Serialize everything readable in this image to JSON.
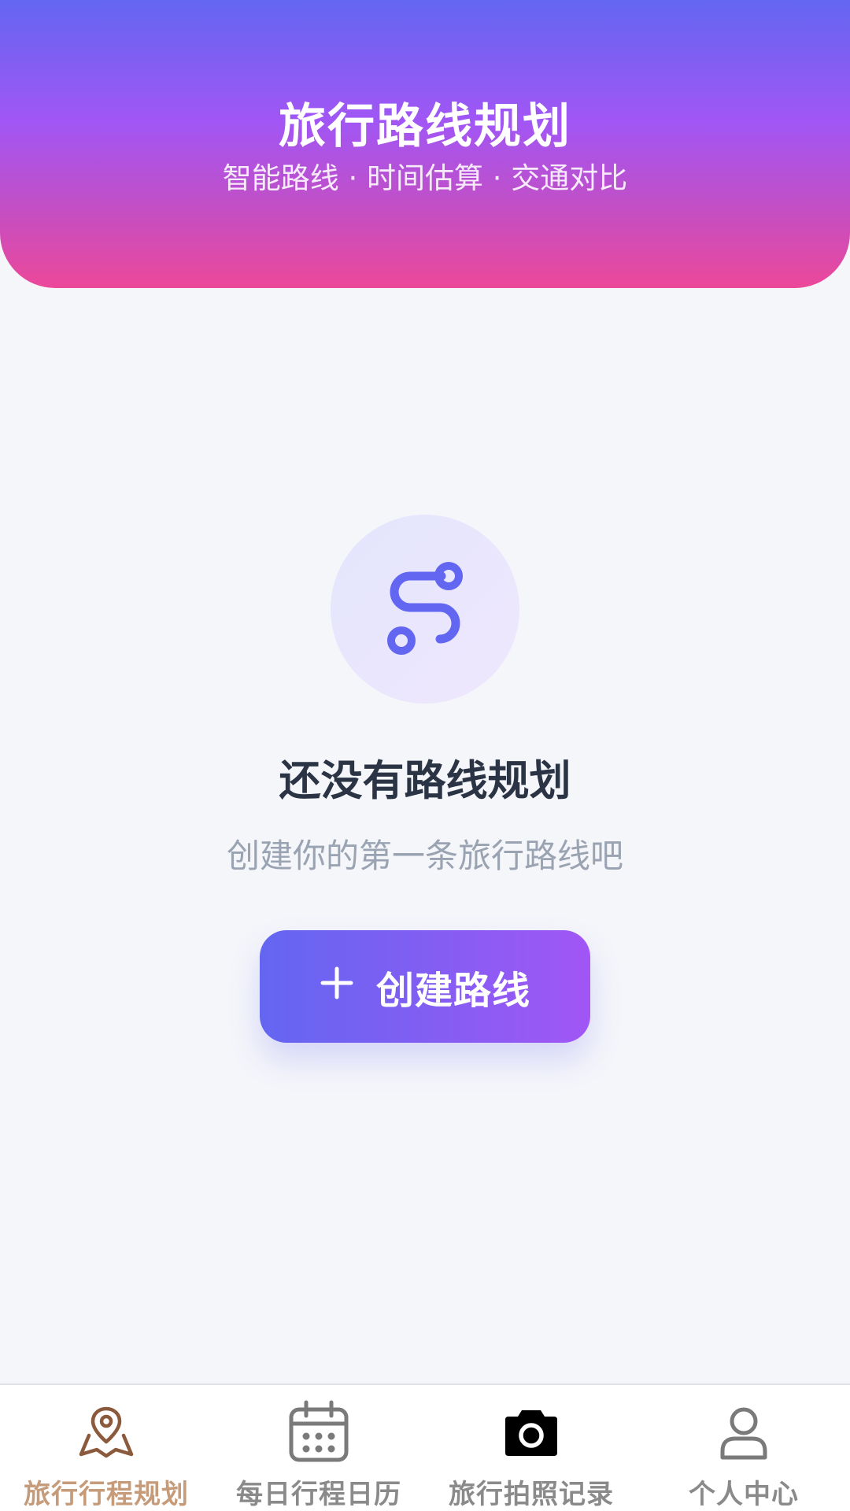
{
  "header": {
    "title": "旅行路线规划",
    "subtitle": "智能路线 · 时间估算 · 交通对比"
  },
  "empty_state": {
    "icon": "route-icon",
    "title": "还没有路线规划",
    "description": "创建你的第一条旅行路线吧",
    "create_button": {
      "icon": "plus-icon",
      "label": "创建路线"
    }
  },
  "bottom_nav": {
    "items": [
      {
        "label": "旅行行程规划",
        "icon": "map-pin-icon",
        "active": true
      },
      {
        "label": "每日行程日历",
        "icon": "calendar-icon",
        "active": false
      },
      {
        "label": "旅行拍照记录",
        "icon": "camera-icon",
        "active": false
      },
      {
        "label": "个人中心",
        "icon": "user-icon",
        "active": false
      }
    ]
  },
  "colors": {
    "header_gradient": [
      "#6366f1",
      "#a156f5",
      "#ec4899"
    ],
    "button_gradient": [
      "#6366f1",
      "#a156f5"
    ],
    "active_tab": "#c59b79",
    "inactive_tab": "#8a8a8a",
    "route_icon": "#6366f1"
  }
}
